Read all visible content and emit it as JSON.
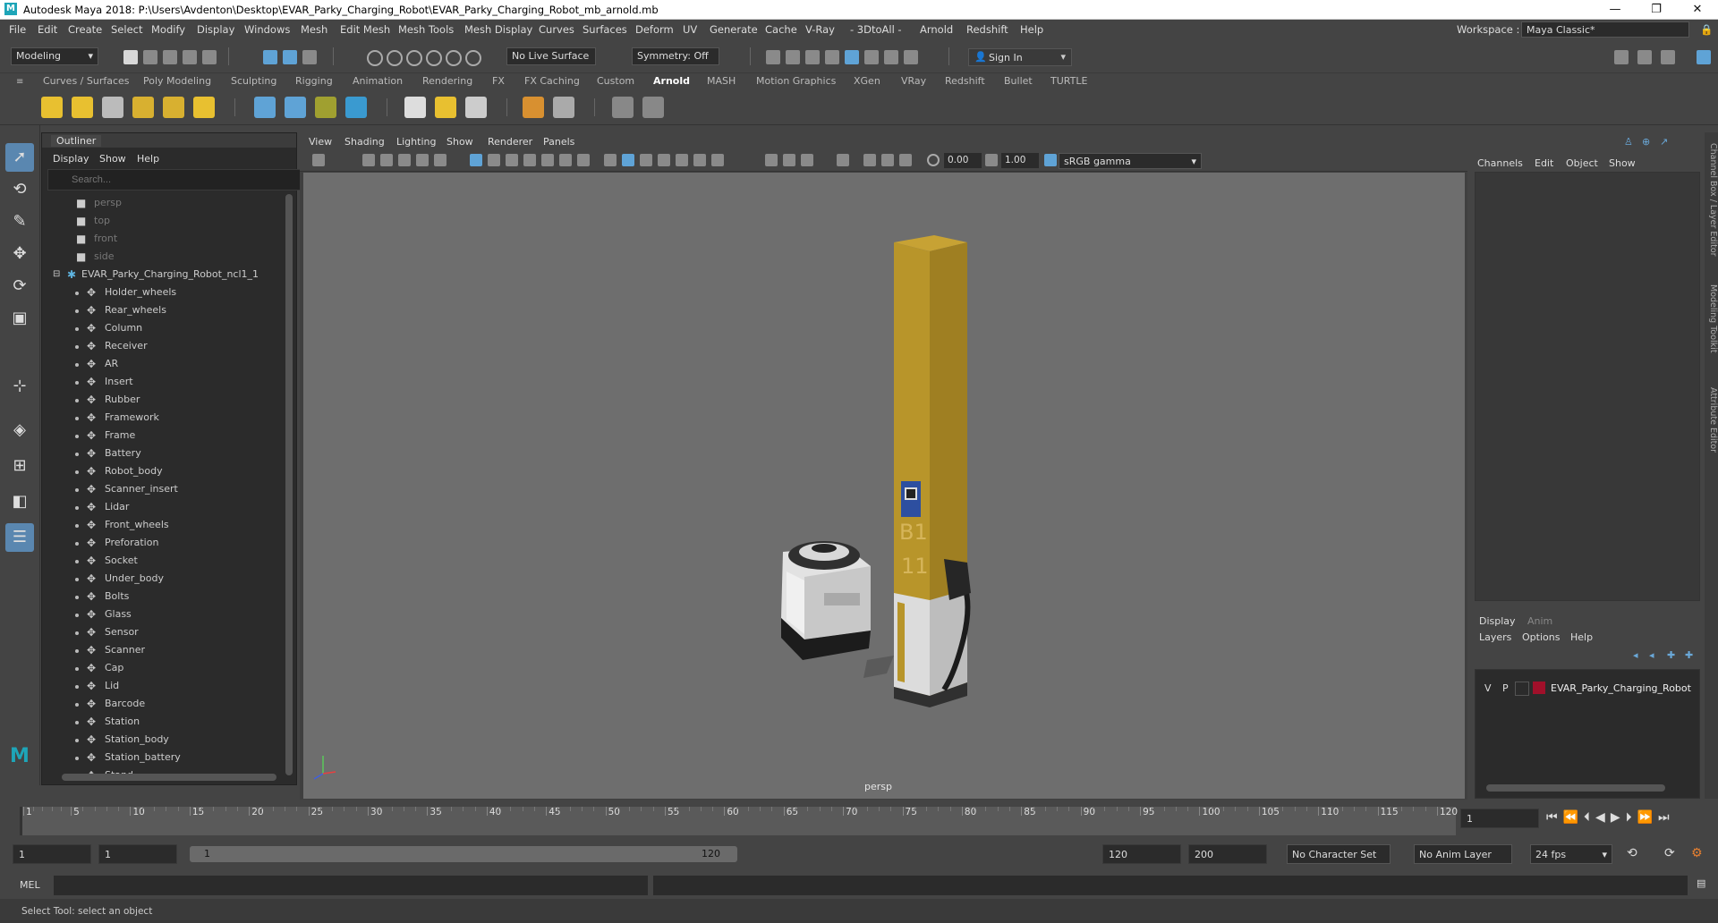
{
  "window": {
    "title": "Autodesk Maya 2018: P:\\Users\\Avdenton\\Desktop\\EVAR_Parky_Charging_Robot\\EVAR_Parky_Charging_Robot_mb_arnold.mb",
    "logo": "M",
    "controls": [
      "—",
      "❐",
      "✕"
    ]
  },
  "menubar": [
    "File",
    "Edit",
    "Create",
    "Select",
    "Modify",
    "Display",
    "Windows",
    "Mesh",
    "Edit Mesh",
    "Mesh Tools",
    "Mesh Display",
    "Curves",
    "Surfaces",
    "Deform",
    "UV",
    "Generate",
    "Cache",
    "V-Ray",
    "- 3DtoAll -",
    "Arnold",
    "Redshift",
    "Help"
  ],
  "workspace": {
    "label": "Workspace :",
    "value": "Maya Classic*"
  },
  "statusline": {
    "mode": "Modeling",
    "live_surface": "No Live Surface",
    "symmetry": "Symmetry: Off",
    "sign_in": "Sign In"
  },
  "shelf_tabs": [
    "Curves / Surfaces",
    "Poly Modeling",
    "Sculpting",
    "Rigging",
    "Animation",
    "Rendering",
    "FX",
    "FX Caching",
    "Custom",
    "Arnold",
    "MASH",
    "Motion Graphics",
    "XGen",
    "VRay",
    "Redshift",
    "Bullet",
    "TURTLE"
  ],
  "active_shelf": "Arnold",
  "outliner": {
    "tab": "Outliner",
    "menu": [
      "Display",
      "Show",
      "Help"
    ],
    "search_placeholder": "Search...",
    "cameras": [
      "persp",
      "top",
      "front",
      "side"
    ],
    "group": "EVAR_Parky_Charging_Robot_ncl1_1",
    "children": [
      "Holder_wheels",
      "Rear_wheels",
      "Column",
      "Receiver",
      "AR",
      "Insert",
      "Rubber",
      "Framework",
      "Frame",
      "Battery",
      "Robot_body",
      "Scanner_insert",
      "Lidar",
      "Front_wheels",
      "Preforation",
      "Socket",
      "Under_body",
      "Bolts",
      "Glass",
      "Sensor",
      "Scanner",
      "Cap",
      "Lid",
      "Barcode",
      "Station",
      "Station_body",
      "Station_battery",
      "Stand"
    ]
  },
  "viewport": {
    "menu": [
      "View",
      "Shading",
      "Lighting",
      "Show",
      "Renderer",
      "Panels"
    ],
    "exposure": "0.00",
    "gamma": "1.00",
    "color_space": "sRGB gamma",
    "camera_label": "persp",
    "station_text": [
      "B1",
      "11"
    ]
  },
  "channel_box": {
    "menu": [
      "Channels",
      "Edit",
      "Object",
      "Show"
    ],
    "side_tabs": [
      "Channel Box / Layer Editor",
      "Modeling Toolkit",
      "Attribute Editor"
    ]
  },
  "layer_editor": {
    "tabs": [
      "Display",
      "Anim"
    ],
    "active_tab": "Display",
    "menu": [
      "Layers",
      "Options",
      "Help"
    ],
    "layer": {
      "v": "V",
      "p": "P",
      "name": "EVAR_Parky_Charging_Robot",
      "color": "#a0102a"
    }
  },
  "timeline": {
    "ticks": [
      "1",
      "5",
      "10",
      "15",
      "20",
      "25",
      "30",
      "35",
      "40",
      "45",
      "50",
      "55",
      "60",
      "65",
      "70",
      "75",
      "80",
      "85",
      "90",
      "95",
      "100",
      "105",
      "110",
      "115",
      "120"
    ],
    "current_frame": "1"
  },
  "range": {
    "start": "1",
    "playback_start": "1",
    "slider_start": "1",
    "slider_end": "120",
    "playback_end": "120",
    "end": "200",
    "character_set": "No Character Set",
    "anim_layer": "No Anim Layer",
    "fps": "24 fps"
  },
  "command": {
    "label": "MEL"
  },
  "help_line": "Select Tool: select an object",
  "colors": {
    "accent": "#5a87b0",
    "station_yellow": "#b8952a",
    "maya_logo": "#1ea5b8"
  }
}
